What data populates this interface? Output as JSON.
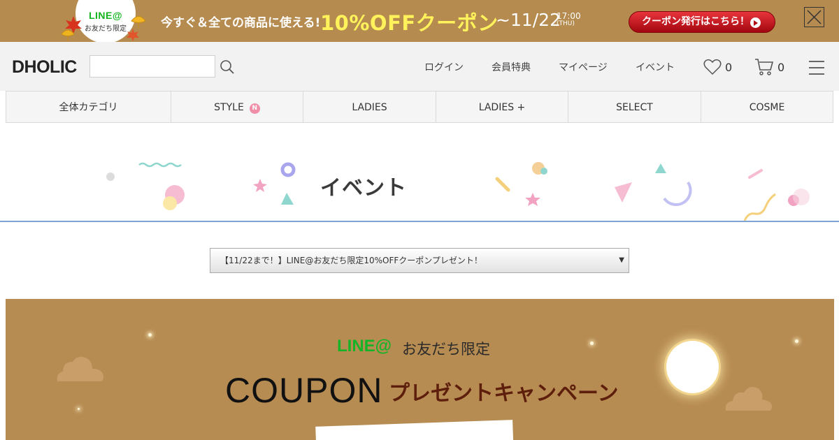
{
  "promo": {
    "badge_line": "LINE@",
    "badge_friends": "お友だち限定",
    "text": "今すぐ＆全ての商品に使える!",
    "coupon": "10%OFFクーポン",
    "date": "~11/22",
    "time": "17:00",
    "weekday": "(THU)",
    "button_label": "クーポン発行はこちら！"
  },
  "header": {
    "logo": "DHOLIC",
    "search": {
      "value": "",
      "placeholder": ""
    },
    "links": [
      "ログイン",
      "会員特典",
      "マイページ",
      "イベント"
    ],
    "wishlist_count": "0",
    "cart_count": "0"
  },
  "categories": [
    {
      "label": "全体カテゴリ"
    },
    {
      "label": "STYLE",
      "badge": "N"
    },
    {
      "label": "LADIES"
    },
    {
      "label": "LADIES +"
    },
    {
      "label": "SELECT"
    },
    {
      "label": "COSME"
    }
  ],
  "event": {
    "title": "イベント",
    "selected": "【11/22まで！】LINE@お友だち限定10%OFFクーポンプレゼント！"
  },
  "coupon_banner": {
    "line": "LINE@",
    "friends": "お友だち限定",
    "coupon": "COUPON",
    "present": "プレゼントキャンペーン"
  },
  "colors": {
    "banner_brown": "#b58b4f",
    "coupon_yellow": "#fff25a",
    "button_red": "#d4212a",
    "line_green": "#16b327",
    "event_underline": "#7ea3d8"
  }
}
